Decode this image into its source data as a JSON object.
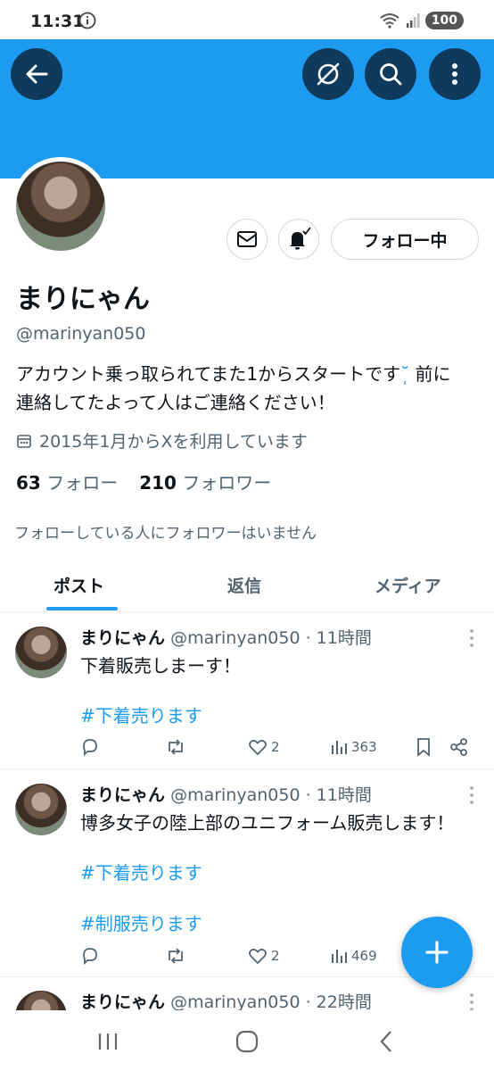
{
  "status_bar": {
    "time": "11:31",
    "battery": "100"
  },
  "profile": {
    "name": "まりにゃん",
    "handle": "@marinyan050",
    "bio_line1": "アカウント乗っ取られてまた1からスタートです",
    "bio_emoji": "˘̩̩",
    "bio_line1_end": " 前に",
    "bio_line2": "連絡してたよって人はご連絡ください！",
    "joined": "2015年1月からXを利用しています",
    "following_count": "63",
    "following_label": "フォロー",
    "followers_count": "210",
    "followers_label": "フォロワー",
    "no_mutual": "フォローしている人にフォロワーはいません",
    "follow_button": "フォロー中"
  },
  "tabs": [
    {
      "label": "ポスト",
      "active": true
    },
    {
      "label": "返信",
      "active": false
    },
    {
      "label": "メディア",
      "active": false
    }
  ],
  "posts": [
    {
      "name": "まりにゃん",
      "meta": "@marinyan050 · 11時間",
      "text": "下着販売しまーす！",
      "hashtags": [
        "#下着売ります"
      ],
      "likes": "2",
      "views": "363"
    },
    {
      "name": "まりにゃん",
      "meta": "@marinyan050 · 11時間",
      "text": "博多女子の陸上部のユニフォーム販売します！",
      "hashtags": [
        "#下着売ります",
        "#制服売ります"
      ],
      "likes": "2",
      "views": "469"
    },
    {
      "name": "まりにゃん",
      "meta": "@marinyan050 · 22時間"
    }
  ],
  "colors": {
    "accent": "#1d9bf0",
    "banner": "#1d9bf0",
    "dark_button": "#0f3a5c"
  }
}
